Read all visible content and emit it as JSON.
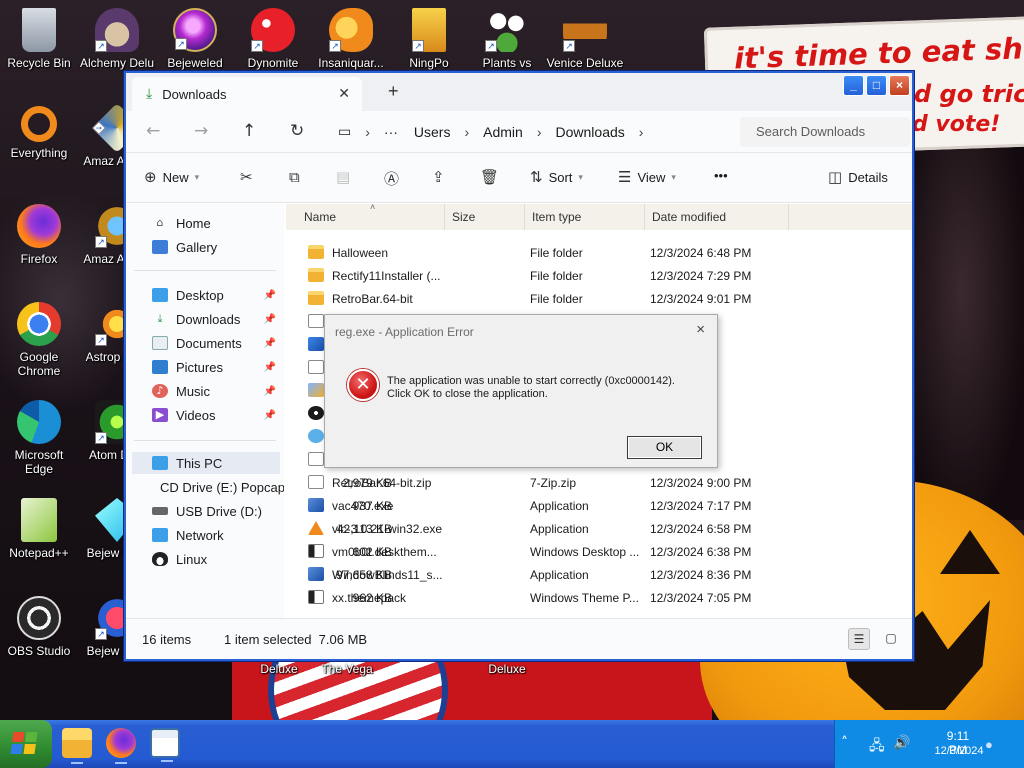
{
  "wallpaper": {
    "line1": "it's time to eat shit",
    "line2": "d go trick",
    "line3": "d vote!",
    "overlap_labels": [
      "Deluxe",
      "The Vega",
      "Deluxe"
    ]
  },
  "desktop_icons": [
    {
      "label": "Recycle Bin",
      "icon": "recycle-bin-icon"
    },
    {
      "label": "Everything",
      "icon": "magnifier-icon"
    },
    {
      "label": "Firefox",
      "icon": "firefox-icon"
    },
    {
      "label": "Google Chrome",
      "icon": "chrome-icon"
    },
    {
      "label": "Microsoft Edge",
      "icon": "edge-icon"
    },
    {
      "label": "Notepad++",
      "icon": "notepadpp-icon"
    },
    {
      "label": "OBS Studio",
      "icon": "obs-icon"
    },
    {
      "label": "Alchemy Delu",
      "icon": "alchemy-icon"
    },
    {
      "label": "Amaz Adven",
      "icon": "amazing-adventures-icon"
    },
    {
      "label": "Amaz Adven",
      "icon": "amazing-adventures-2-icon"
    },
    {
      "label": "Astrop Delu",
      "icon": "astropop-icon"
    },
    {
      "label": "Atom Delu",
      "icon": "atomica-icon"
    },
    {
      "label": "Bejew Delu",
      "icon": "bejeweled-deluxe-icon"
    },
    {
      "label": "Bejew Delu",
      "icon": "bejeweled-deluxe-2-icon"
    },
    {
      "label": "Bejeweled",
      "icon": "bejeweled-icon"
    },
    {
      "label": "Dynomite",
      "icon": "dynomite-icon"
    },
    {
      "label": "Insaniquar...",
      "icon": "insaniquarium-icon"
    },
    {
      "label": "NingPo",
      "icon": "ningpo-icon"
    },
    {
      "label": "Plants vs",
      "icon": "plants-vs-zombies-icon"
    },
    {
      "label": "Venice Deluxe",
      "icon": "venice-icon"
    }
  ],
  "window": {
    "tab_title": "Downloads",
    "caption": {
      "minimize": "_",
      "maximize": "□",
      "close": "×"
    },
    "breadcrumb": [
      "Users",
      "Admin",
      "Downloads"
    ],
    "search_placeholder": "Search Downloads",
    "toolbar": {
      "new": "New",
      "sort": "Sort",
      "view": "View",
      "more": "•••",
      "details": "Details"
    },
    "nav": {
      "home": "Home",
      "gallery": "Gallery",
      "desktop": "Desktop",
      "downloads": "Downloads",
      "documents": "Documents",
      "pictures": "Pictures",
      "music": "Music",
      "videos": "Videos",
      "this_pc": "This PC",
      "cd_drive": "CD Drive (E:) Popcap",
      "usb_drive": "USB Drive (D:)",
      "network": "Network",
      "linux": "Linux"
    },
    "columns": {
      "name": "Name",
      "size": "Size",
      "type": "Item type",
      "date": "Date modified"
    },
    "files": [
      {
        "name": "Halloween",
        "size": "",
        "type": "File folder",
        "date": "12/3/2024 6:48 PM",
        "icon": "folder-icon"
      },
      {
        "name": "Rectify11Installer (...",
        "size": "",
        "type": "File folder",
        "date": "12/3/2024 7:29 PM",
        "icon": "folder-icon"
      },
      {
        "name": "RetroBar.64-bit",
        "size": "",
        "type": "File folder",
        "date": "12/3/2024 9:01 PM",
        "icon": "folder-icon"
      },
      {
        "name": "",
        "size": "",
        "type": "",
        "date": ":09 AM",
        "icon": "document-icon"
      },
      {
        "name": "",
        "size": "",
        "type": "",
        "date": ":3 PM",
        "icon": "installer-icon"
      },
      {
        "name": "",
        "size": "",
        "type": "",
        "date": ":7 PM",
        "icon": "document-icon"
      },
      {
        "name": "",
        "size": "",
        "type": "",
        "date": ":9 PM",
        "icon": "setup-icon"
      },
      {
        "name": "",
        "size": "",
        "type": "",
        "date": ":0 PM",
        "icon": "disc-icon"
      },
      {
        "name": "",
        "size": "",
        "type": "",
        "date": ":4 PM",
        "icon": "cloud-icon"
      },
      {
        "name": "",
        "size": "",
        "type": "",
        "date": ":8 PM",
        "icon": "document-icon"
      },
      {
        "name": "RetroBar.64-bit.zip",
        "size": "2,979 KB",
        "type": "7-Zip.zip",
        "date": "12/3/2024 9:00 PM",
        "icon": "zip-icon"
      },
      {
        "name": "vac470.exe",
        "size": "937 KB",
        "type": "Application",
        "date": "12/3/2024 7:17 PM",
        "icon": "exe-icon"
      },
      {
        "name": "vlc-3.0.21-win32.exe",
        "size": "42,113 KB",
        "type": "Application",
        "date": "12/3/2024 6:58 PM",
        "icon": "vlc-icon"
      },
      {
        "name": "vm0b0t.deskthem...",
        "size": "602 KB",
        "type": "Windows Desktop ...",
        "date": "12/3/2024 6:38 PM",
        "icon": "theme-icon"
      },
      {
        "name": "WindowBlinds11_s...",
        "size": "97,658 KB",
        "type": "Application",
        "date": "12/3/2024 8:36 PM",
        "icon": "exe-icon"
      },
      {
        "name": "xx.themepack",
        "size": "962 KB",
        "type": "Windows Theme P...",
        "date": "12/3/2024 7:05 PM",
        "icon": "theme-icon"
      }
    ],
    "status": {
      "count": "16 items",
      "selection": "1 item selected  7.06 MB"
    }
  },
  "dialog": {
    "title": "reg.exe - Application Error",
    "message_line1": "The application was unable to start correctly (0xc0000142).",
    "message_line2": "Click OK to close the application.",
    "ok": "OK",
    "close": "×"
  },
  "taskbar": {
    "time": "9:11 PM",
    "date": "12/3/2024",
    "apps": [
      "file-explorer-icon",
      "firefox-icon",
      "app-window-icon"
    ]
  }
}
